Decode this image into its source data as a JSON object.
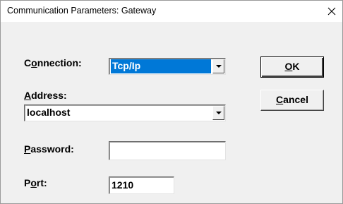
{
  "window": {
    "title": "Communication Parameters: Gateway"
  },
  "form": {
    "connection": {
      "label_pre": "C",
      "label_accel": "o",
      "label_post": "nnection:",
      "value": "Tcp/Ip"
    },
    "address": {
      "label_pre": "",
      "label_accel": "A",
      "label_post": "ddress:",
      "value": "localhost"
    },
    "password": {
      "label_pre": "",
      "label_accel": "P",
      "label_post": "assword:",
      "value": ""
    },
    "port": {
      "label_pre": "P",
      "label_accel": "o",
      "label_post": "rt:",
      "value": "1210"
    }
  },
  "buttons": {
    "ok_accel": "O",
    "ok_rest": "K",
    "cancel_accel": "C",
    "cancel_rest": "ancel"
  },
  "icons": {
    "close": "close-icon",
    "dropdown": "chevron-down-icon"
  },
  "colors": {
    "selection": "#0078d7",
    "dialog_bg": "#f0f0f0"
  }
}
